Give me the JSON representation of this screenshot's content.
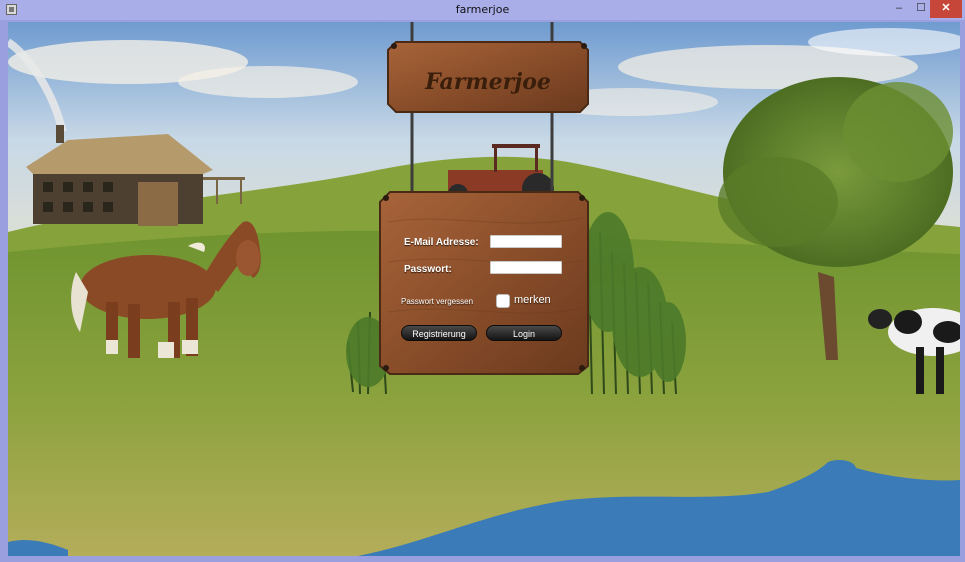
{
  "window": {
    "title": "farmerjoe",
    "controls": {
      "minimize": "–",
      "maximize": "☐",
      "close": "✕"
    }
  },
  "logo": {
    "text": "Farmerjoe"
  },
  "login": {
    "email_label": "E-Mail Adresse:",
    "email_value": "",
    "password_label": "Passwort:",
    "password_value": "",
    "forgot_link": "Passwort vergessen",
    "remember_label": "merken",
    "remember_checked": false,
    "register_button": "Registrierung",
    "login_button": "Login"
  },
  "colors": {
    "sky_top": "#6f9bd0",
    "grass": "#7f9b34",
    "water": "#3b7bb7",
    "wood": "#8a4e2a"
  },
  "icons": [
    "app-icon",
    "minimize-icon",
    "maximize-icon",
    "close-icon"
  ]
}
